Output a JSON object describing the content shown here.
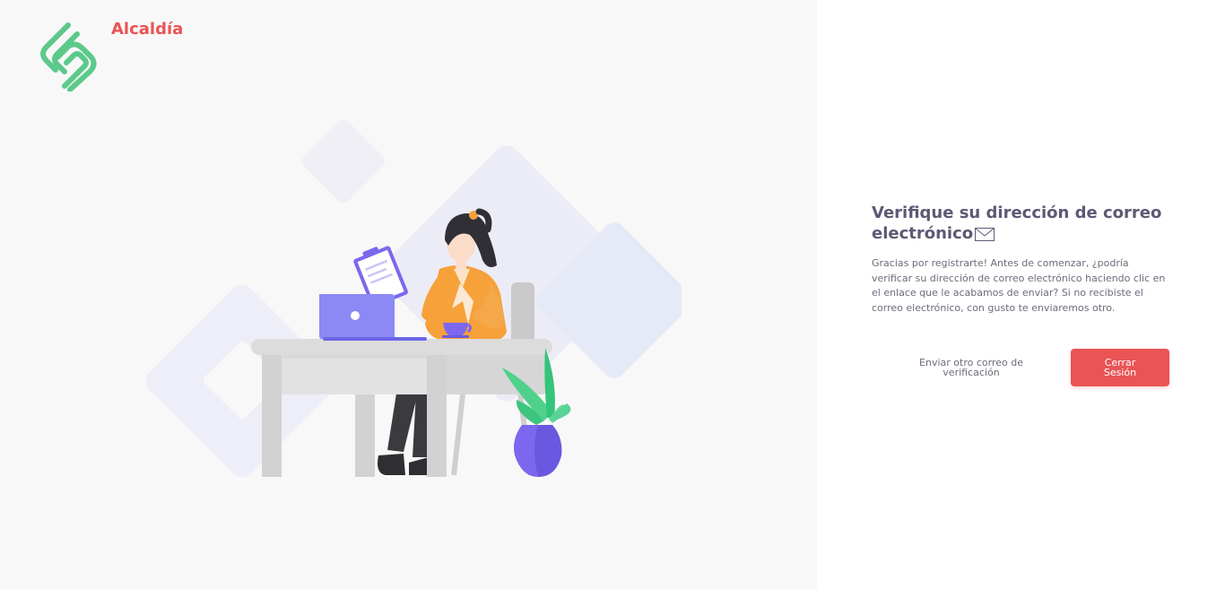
{
  "brand": {
    "name": "Alcaldía",
    "color": "#ea5455",
    "logo_icon": "stacked-s-logo-icon",
    "logo_color": "#5cc98a"
  },
  "illustration": {
    "subject": "woman-at-desk-with-laptop-and-clipboard"
  },
  "verify": {
    "title": "Verifique su dirección de correo electrónico",
    "title_icon": "envelope-icon",
    "message": "Gracias por registrarte! Antes de comenzar, ¿podría verificar su dirección de correo electrónico haciendo clic en el enlace que le acabamos de enviar? Si no recibiste el correo electrónico, con gusto te enviaremos otro.",
    "resend_label": "Enviar otro correo de verificación",
    "logout_label": "Cerrar Sesión"
  },
  "colors": {
    "accent": "#ea5455",
    "heading": "#5e5873",
    "text": "#6e6b7b",
    "left_background": "#f8f8f8"
  }
}
